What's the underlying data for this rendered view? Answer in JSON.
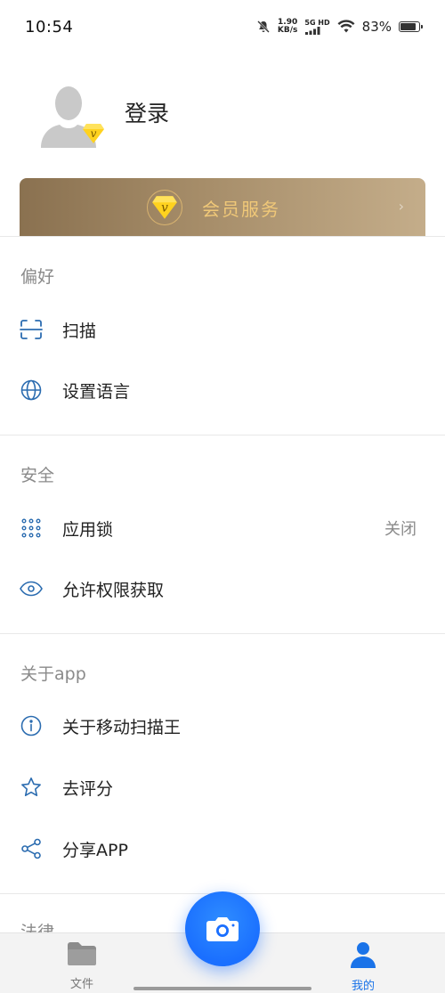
{
  "status_bar": {
    "time": "10:54",
    "speed_value": "1.90",
    "speed_unit": "KB/s",
    "network": "5G HD",
    "battery": "83%",
    "battery_level": 0.83
  },
  "profile": {
    "login_label": "登录",
    "badge_letter": "v"
  },
  "member": {
    "label": "会员服务",
    "arrow": "›"
  },
  "sections": {
    "preferences": {
      "title": "偏好",
      "items": [
        {
          "label": "扫描",
          "icon": "scan-icon"
        },
        {
          "label": "设置语言",
          "icon": "globe-icon"
        }
      ]
    },
    "security": {
      "title": "安全",
      "items": [
        {
          "label": "应用锁",
          "icon": "keypad-icon",
          "value": "关闭"
        },
        {
          "label": "允许权限获取",
          "icon": "eye-icon"
        }
      ]
    },
    "about": {
      "title": "关于app",
      "items": [
        {
          "label": "关于移动扫描王",
          "icon": "info-icon"
        },
        {
          "label": "去评分",
          "icon": "star-icon"
        },
        {
          "label": "分享APP",
          "icon": "share-icon"
        }
      ]
    },
    "legal": {
      "title": "法律"
    }
  },
  "bottom_nav": {
    "files_label": "文件",
    "mine_label": "我的"
  },
  "colors": {
    "accent": "#1a73e8",
    "member_gold": "#f0c878",
    "icon_blue": "#2b6cb0"
  }
}
